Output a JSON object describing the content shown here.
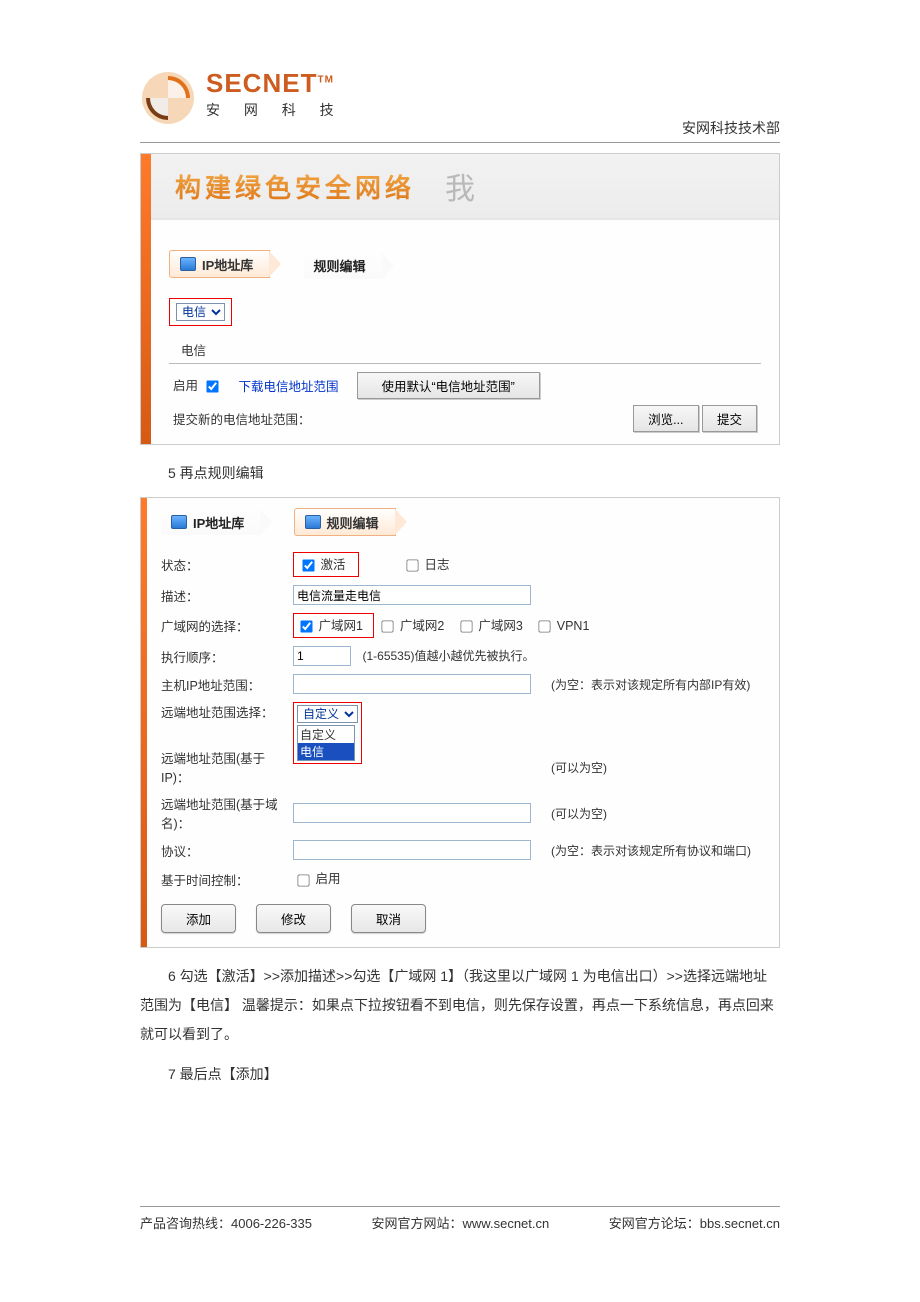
{
  "logo": {
    "brand": "SECNET",
    "tm": "TM",
    "sub": "安 网 科 技"
  },
  "header_right": "安网科技技术部",
  "shot1": {
    "banner_title": "构建绿色安全网络",
    "banner_script": "我",
    "tab_ip": "IP地址库",
    "tab_rule": "规则编辑",
    "select_value": "电信",
    "section_legend": "电信",
    "enable_label": "启用",
    "download_label": "下载电信地址范围",
    "use_default_btn": "使用默认“电信地址范围”",
    "submit_label": "提交新的电信地址范围：",
    "browse_btn": "浏览...",
    "submit_btn": "提交"
  },
  "step5": "5 再点规则编辑",
  "shot2": {
    "tab_ip": "IP地址库",
    "tab_rule": "规则编辑",
    "labels": {
      "state": "状态：",
      "desc": "描述：",
      "wan": "广域网的选择：",
      "order": "执行顺序：",
      "host_range": "主机IP地址范围：",
      "remote_sel": "远端地址范围选择：",
      "remote_ip": "远端地址范围(基于IP)：",
      "remote_dom": "远端地址范围(基于域名)：",
      "proto": "协议：",
      "time": "基于时间控制："
    },
    "state_activate": "激活",
    "state_log": "日志",
    "desc_value": "电信流量走电信",
    "wan_opts": {
      "wan1": "广域网1",
      "wan2": "广域网2",
      "wan3": "广域网3",
      "vpn1": "VPN1"
    },
    "order_value": "1",
    "order_hint": "(1-65535)值越小越优先被执行。",
    "host_note": "(为空：表示对该规定所有内部IP有效)",
    "remote_sel_value": "自定义",
    "remote_list_custom": "自定义",
    "remote_list_ct": "电信",
    "remote_ip_note": "(可以为空)",
    "remote_dom_note": "(可以为空)",
    "proto_note": "(为空：表示对该规定所有协议和端口)",
    "time_enable": "启用",
    "btn_add": "添加",
    "btn_mod": "修改",
    "btn_cancel": "取消"
  },
  "para6": "6 勾选【激活】>>添加描述>>勾选【广域网 1】（我这里以广域网 1 为电信出口）>>选择远端地址范围为【电信】 温馨提示：如果点下拉按钮看不到电信，则先保存设置，再点一下系统信息，再点回来就可以看到了。",
  "para7": "7 最后点【添加】",
  "footer": {
    "hotline_label": "产品咨询热线：",
    "hotline": "4006-226-335",
    "site_label": "安网官方网站：",
    "site": "www.secnet.cn",
    "bbs_label": "安网官方论坛：",
    "bbs": "bbs.secnet.cn"
  }
}
